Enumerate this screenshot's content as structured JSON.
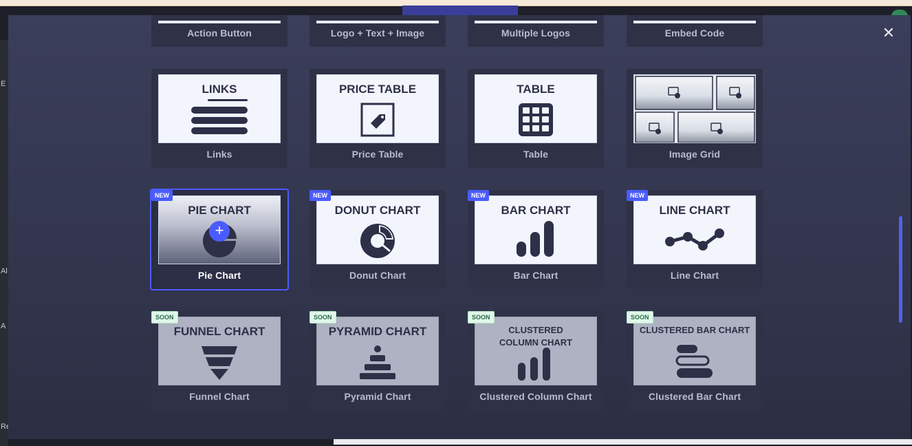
{
  "modal": {
    "close_symbol": "✕",
    "rows": [
      {
        "short": true,
        "cards": [
          {
            "label": "Action Button"
          },
          {
            "label": "Logo + Text + Image"
          },
          {
            "label": "Multiple Logos"
          },
          {
            "label": "Embed Code"
          }
        ]
      },
      {
        "cards": [
          {
            "label": "Links",
            "title": "LINKS",
            "icon": "links-list-icon"
          },
          {
            "label": "Price Table",
            "title": "PRICE TABLE",
            "icon": "price-tag-icon"
          },
          {
            "label": "Table",
            "title": "TABLE",
            "icon": "table-grid-icon"
          },
          {
            "label": "Image Grid",
            "title": "",
            "icon": "image-grid-icon"
          }
        ]
      },
      {
        "cards": [
          {
            "label": "Pie Chart",
            "title": "PIE CHART",
            "badge": "NEW",
            "icon": "pie-chart-icon",
            "active": true
          },
          {
            "label": "Donut Chart",
            "title": "DONUT CHART",
            "badge": "NEW",
            "icon": "donut-chart-icon"
          },
          {
            "label": "Bar Chart",
            "title": "BAR CHART",
            "badge": "NEW",
            "icon": "bar-chart-icon"
          },
          {
            "label": "Line Chart",
            "title": "LINE CHART",
            "badge": "NEW",
            "icon": "line-chart-icon"
          }
        ]
      },
      {
        "cards": [
          {
            "label": "Funnel Chart",
            "title": "FUNNEL CHART",
            "badge": "SOON",
            "icon": "funnel-chart-icon"
          },
          {
            "label": "Pyramid Chart",
            "title": "PYRAMID CHART",
            "badge": "SOON",
            "icon": "pyramid-chart-icon"
          },
          {
            "label": "Clustered Column Chart",
            "title": "CLUSTERED\nCOLUMN CHART",
            "badge": "SOON",
            "icon": "clustered-column-chart-icon"
          },
          {
            "label": "Clustered Bar Chart",
            "title": "CLUSTERED BAR CHART",
            "badge": "SOON",
            "icon": "clustered-bar-chart-icon"
          }
        ]
      }
    ]
  },
  "background": {
    "left_labels": [
      "E",
      "Al",
      "A",
      "Re"
    ]
  },
  "colors": {
    "accent": "#4a5cff",
    "modal_bg": "#363950",
    "card_bg": "#2f3247",
    "soon_badge": "#dff7e9"
  }
}
